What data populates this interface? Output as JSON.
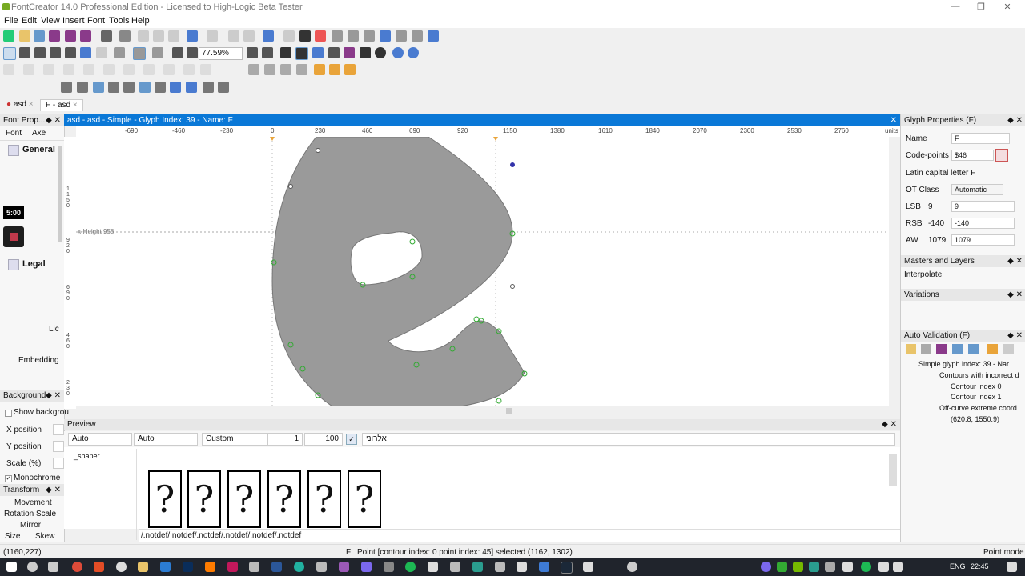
{
  "app_title": "FontCreator 14.0 Professional Edition - Licensed to High-Logic Beta Tester",
  "menu": [
    "File",
    "Edit",
    "View",
    "Insert",
    "Font",
    "Tools",
    "Help"
  ],
  "toolbar": {
    "zoom": "77.59%"
  },
  "doc_tabs": [
    {
      "label": "asd"
    },
    {
      "label": "F - asd"
    }
  ],
  "left_panel": {
    "title": "Font Prop...",
    "tabs": [
      "Font",
      "Axe"
    ],
    "general": "General",
    "legal": "Legal",
    "lic": "Lic",
    "embedding": "Embedding"
  },
  "overlay": {
    "timer": "5:00"
  },
  "background_panel": {
    "title": "Background",
    "show_background": "Show backgrou",
    "x_position": "X position",
    "y_position": "Y position",
    "scale": "Scale (%)",
    "monochrome": "Monochrome"
  },
  "transform_panel": {
    "title": "Transform",
    "items": [
      "Movement",
      "Rotation",
      "Scale",
      "Mirror",
      "Size",
      "Skew"
    ]
  },
  "editor": {
    "title": "asd - asd - Simple - Glyph Index: 39 - Name: F",
    "ruler_ticks": [
      "-690",
      "-460",
      "-230",
      "0",
      "230",
      "460",
      "690",
      "920",
      "1150",
      "1380",
      "1610",
      "1840",
      "2070",
      "2300",
      "2530",
      "2760"
    ],
    "ruler_units": "units",
    "x_height_label": "x-Height 958",
    "vruler_labels": [
      "1\n1\n5\n0",
      "9\n2\n0",
      "6\n9\n0",
      "4\n6\n0",
      "2\n3\n0"
    ]
  },
  "preview": {
    "title": "Preview",
    "dropdowns": [
      "Auto",
      "Auto",
      "Custom"
    ],
    "spin1": "1",
    "spin2": "100",
    "text": "אלרוני",
    "shaper": "_shaper",
    "glyphs": [
      "?",
      "?",
      "?",
      "?",
      "?",
      "?"
    ],
    "glyph_string": "/.notdef/.notdef/.notdef/.notdef/.notdef/.notdef"
  },
  "glyph_properties": {
    "title": "Glyph Properties (F)",
    "name_label": "Name",
    "name_value": "F",
    "codepoints_label": "Code-points",
    "codepoints_value": "$46",
    "description": "Latin capital letter F",
    "otclass_label": "OT Class",
    "otclass_value": "Automatic",
    "lsb_label": "LSB",
    "lsb_value": "9",
    "lsb_input": "9",
    "rsb_label": "RSB",
    "rsb_value": "-140",
    "rsb_input": "-140",
    "aw_label": "AW",
    "aw_value": "1079",
    "aw_input": "1079"
  },
  "masters_layers": {
    "title": "Masters and Layers",
    "interpolate": "Interpolate"
  },
  "variations": {
    "title": "Variations"
  },
  "auto_validation": {
    "title": "Auto Validation (F)",
    "tree": [
      "Simple glyph index: 39 - Nar",
      "Contours with incorrect d",
      "Contour index 0",
      "Contour index 1",
      "Off-curve extreme coord",
      "(620.8, 1550.9)"
    ]
  },
  "status": {
    "coords": "(1160,227)",
    "glyph": "F",
    "message": "Point [contour index: 0 point index: 45] selected (1162, 1302)",
    "mode": "Point mode"
  },
  "taskbar": {
    "lang": "ENG",
    "time": "22:45"
  }
}
